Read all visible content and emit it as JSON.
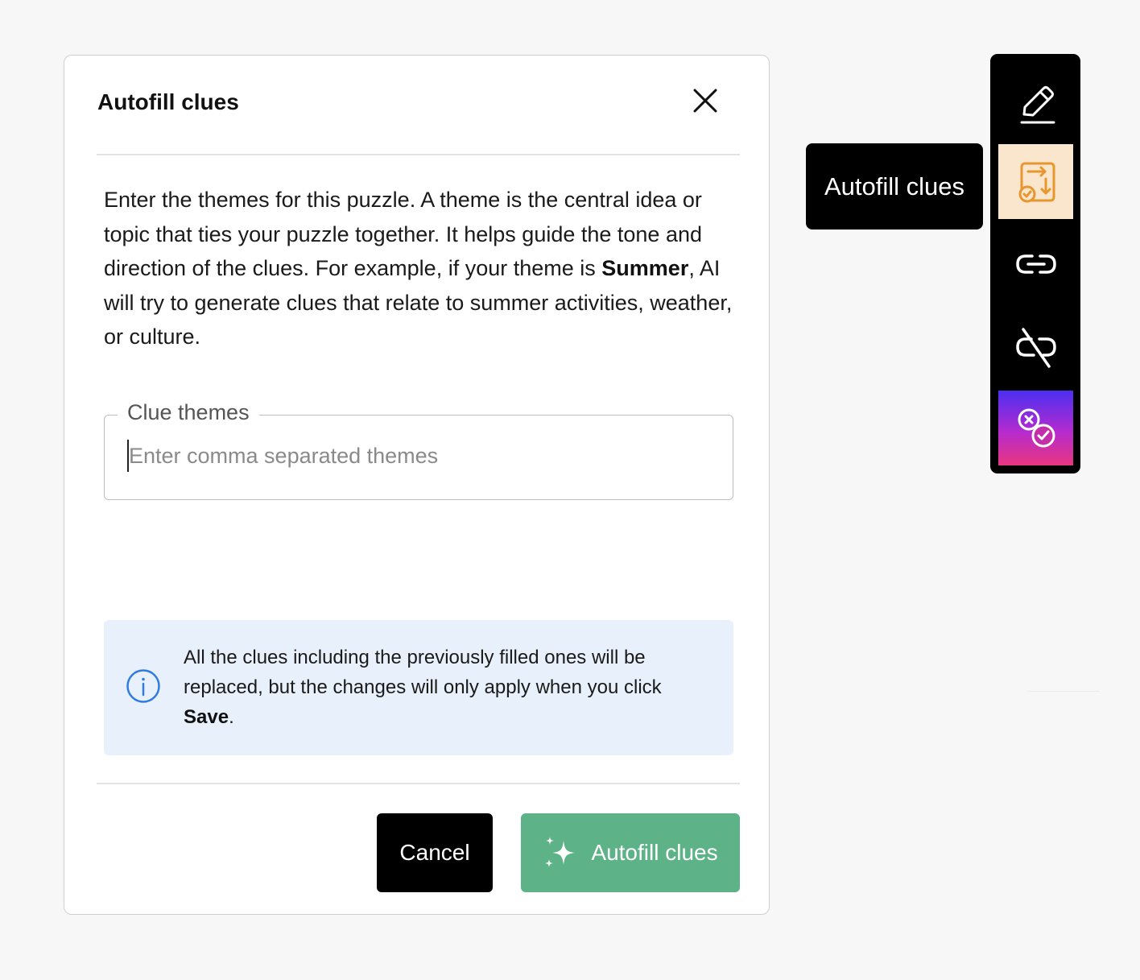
{
  "dialog": {
    "title": "Autofill clues",
    "description": {
      "before_bold": "Enter the themes for this puzzle. A theme is the central idea or topic that ties your puzzle together. It helps guide the tone and direction of the clues. For example, if your theme is ",
      "bold": "Summer",
      "after_bold": ", AI will try to generate clues that relate to summer activities, weather, or culture."
    },
    "field": {
      "label": "Clue themes",
      "placeholder": "Enter comma separated themes",
      "value": ""
    },
    "info": {
      "text_before": "All the clues including the previously filled ones will be replaced, but the changes will only apply when you click ",
      "bold": "Save",
      "text_after": "."
    },
    "buttons": {
      "cancel": "Cancel",
      "autofill": "Autofill clues"
    }
  },
  "tooltip": {
    "text": "Autofill clues"
  },
  "toolbar": {
    "items": [
      {
        "icon": "pencil-icon",
        "active": false
      },
      {
        "icon": "autofill-clues-icon",
        "active": true
      },
      {
        "icon": "link-icon",
        "active": false
      },
      {
        "icon": "unlink-icon",
        "active": false
      },
      {
        "icon": "toggle-check-icon",
        "active": false
      }
    ]
  },
  "colors": {
    "primary_green": "#5db287",
    "info_background": "#e8f1fb",
    "info_icon": "#2f7be0",
    "active_toolbar_bg": "#fae6cc",
    "active_toolbar_icon": "#e8962e",
    "gradient_start": "#4b2ff0",
    "gradient_end": "#e8357f"
  }
}
